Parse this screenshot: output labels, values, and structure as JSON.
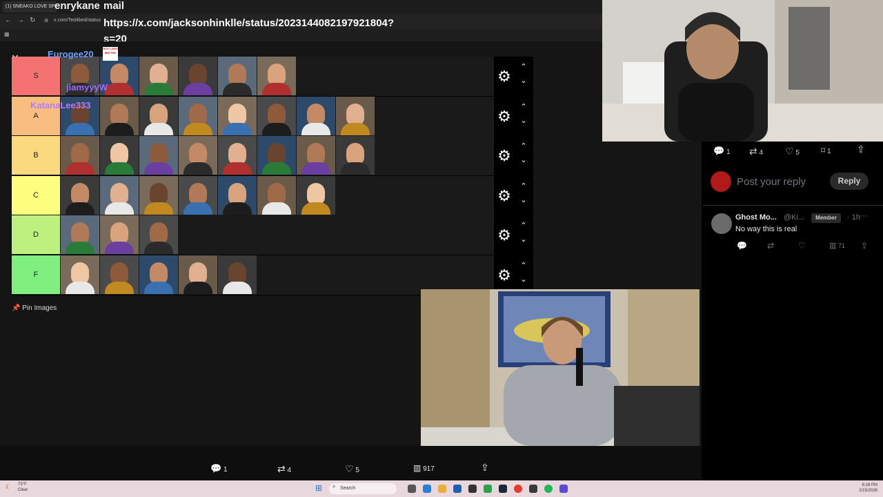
{
  "browser": {
    "tab_title": "(1) SNEAKO LOVE SPE",
    "address_partial": "x.com/Ted4bed/status",
    "nav_back": "←",
    "nav_forward": "→",
    "nav_reload": "↻"
  },
  "stream_overlay": {
    "name": "enrykane",
    "mail_label": "mail",
    "url_text": "https://x.com/jacksonhinklle/status/2023144082197921804?s=20"
  },
  "tier_list": {
    "close_icon": "×",
    "tiers": [
      {
        "label": "S",
        "color": "#f47272",
        "count": 6
      },
      {
        "label": "A",
        "color": "#f9bd80",
        "count": 8
      },
      {
        "label": "B",
        "color": "#fbda7f",
        "count": 8
      },
      {
        "label": "C",
        "color": "#fefe7f",
        "count": 7
      },
      {
        "label": "D",
        "color": "#bdf07f",
        "count": 3
      },
      {
        "label": "F",
        "color": "#7ff07f",
        "count": 5
      }
    ],
    "gear_icon": "gear-icon",
    "up_icon": "⌃",
    "down_icon": "⌄",
    "pin_images_label": "Pin Images"
  },
  "chat_overlay": [
    {
      "text": "Eurogee20",
      "color": "#6fa0ff"
    },
    {
      "text": "GOY LIVES MATTER",
      "color": "#d00000"
    },
    {
      "text": "jiamyyyW",
      "color": "#a06bff"
    },
    {
      "text": "KatanaLee333",
      "color": "#b07bff"
    }
  ],
  "bottom_actions": {
    "replies": "1",
    "reposts": "4",
    "likes": "5",
    "views": "917"
  },
  "right_panel": {
    "actions": {
      "replies": "1",
      "reposts": "4",
      "likes": "5",
      "bookmarks": "1"
    },
    "reply_placeholder": "Post your reply",
    "reply_button": "Reply",
    "reply": {
      "name": "Ghost Mo...",
      "handle": "@Ki...",
      "badge": "Member",
      "time": "· 1h",
      "more": "···",
      "text": "No way this is real",
      "views": "71"
    }
  },
  "taskbar": {
    "weather_temp": "73°F",
    "weather_desc": "Clear",
    "search_placeholder": "Search",
    "time": "8:18 PM",
    "date": "2/15/2026"
  }
}
